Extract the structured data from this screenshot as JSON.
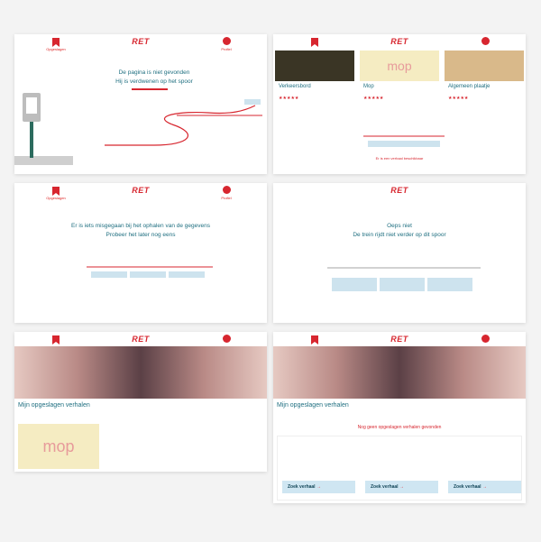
{
  "header": {
    "logo": "RET",
    "left_label": "Opgeslagen",
    "right_label": "Profiel"
  },
  "screens": {
    "s1": {
      "message_line1": "De pagina is niet gevonden",
      "message_line2": "Hij is verdwenen op het spoor"
    },
    "s2": {
      "cards": [
        {
          "title": "Verkeersbord",
          "stars": "★★★★★"
        },
        {
          "title": "Mop",
          "stars": "★★★★★"
        },
        {
          "title": "Algemeen plaatje",
          "stars": "★★★★★"
        }
      ],
      "footer_text": "Er is een verhaal beschikbaar"
    },
    "s3": {
      "message_line1": "Er is iets misgegaan bij het ophalen van de gegevens",
      "message_line2": "Probeer het later nog eens"
    },
    "s4": {
      "message_line1": "Oeps niet",
      "message_line2": "De trein rijdt niet verder op dit spoor"
    },
    "s5": {
      "title": "Mijn opgeslagen verhalen",
      "tile_text": "mop"
    },
    "s6": {
      "title": "Mijn opgeslagen verhalen",
      "subtitle": "Nog geen opgeslagen verhalen gevonden",
      "buttons": [
        "Zoek verhaal",
        "Zoek verhaal",
        "Zoek verhaal"
      ]
    }
  },
  "colors": {
    "accent": "#d7262f",
    "teal": "#1f6f80",
    "light_blue": "#cfe6f2"
  }
}
